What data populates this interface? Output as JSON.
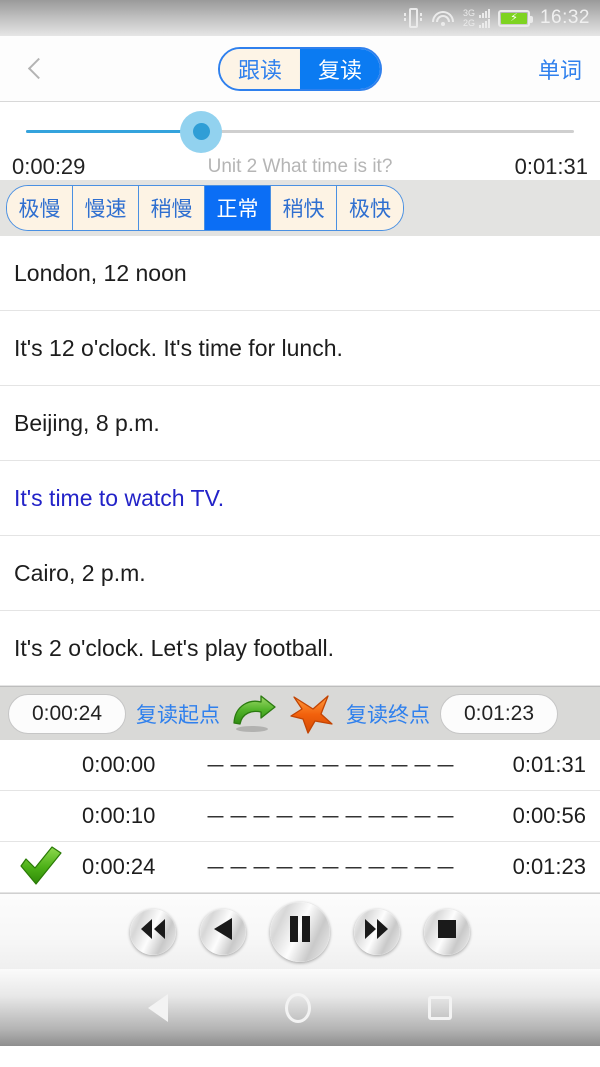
{
  "statusbar": {
    "time": "16:32",
    "signal_primary": "3G",
    "signal_secondary": "2G",
    "icons": [
      "vibrate-icon",
      "wifi-icon",
      "signal-icon",
      "battery-charging-icon"
    ]
  },
  "titlebar": {
    "back_icon": "chevron-left-icon",
    "tabs": [
      {
        "label": "跟读",
        "active": false
      },
      {
        "label": "复读",
        "active": true
      }
    ],
    "right_action": "单词"
  },
  "player": {
    "current_time": "0:00:29",
    "total_time": "0:01:31",
    "unit_title": "Unit 2 What time is it?",
    "progress_percent": 32,
    "track_color": "#34a3dd",
    "thumb_color": "#2f9ed6"
  },
  "speed": {
    "options": [
      {
        "label": "极慢",
        "selected": false
      },
      {
        "label": "慢速",
        "selected": false
      },
      {
        "label": "稍慢",
        "selected": false
      },
      {
        "label": "正常",
        "selected": true
      },
      {
        "label": "稍快",
        "selected": false
      },
      {
        "label": "极快",
        "selected": false
      }
    ],
    "selected_color": "#0b6ef5"
  },
  "sentences": [
    {
      "text": "London, 12 noon",
      "highlighted": false
    },
    {
      "text": "It's 12 o'clock. It's time for lunch.",
      "highlighted": false
    },
    {
      "text": "Beijing, 8 p.m.",
      "highlighted": false
    },
    {
      "text": "It's time to watch TV.",
      "highlighted": true
    },
    {
      "text": "Cairo, 2 p.m.",
      "highlighted": false
    },
    {
      "text": "It's 2 o'clock. Let's play football.",
      "highlighted": false
    }
  ],
  "repeat": {
    "start_value": "0:00:24",
    "start_label": "复读起点",
    "end_label": "复读终点",
    "end_value": "0:01:23",
    "start_icon": "curved-arrow-right-icon",
    "end_icon": "arrow-up-right-icon"
  },
  "markers": {
    "separator": "－－－－－－－－－－－",
    "rows": [
      {
        "checked": false,
        "start": "0:00:00",
        "end": "0:01:31"
      },
      {
        "checked": false,
        "start": "0:00:10",
        "end": "0:00:56"
      },
      {
        "checked": true,
        "start": "0:00:24",
        "end": "0:01:23"
      }
    ],
    "check_icon": "green-checkmark-icon"
  },
  "transport": {
    "buttons": [
      {
        "name": "rewind-button",
        "icon": "rewind-icon",
        "size": "small"
      },
      {
        "name": "previous-button",
        "icon": "play-left-icon",
        "size": "small"
      },
      {
        "name": "pause-button",
        "icon": "pause-icon",
        "size": "big"
      },
      {
        "name": "fast-forward-button",
        "icon": "fast-forward-icon",
        "size": "small"
      },
      {
        "name": "stop-button",
        "icon": "stop-icon",
        "size": "small"
      }
    ]
  },
  "navbar": {
    "back": "nav-back-icon",
    "home": "nav-home-icon",
    "recent": "nav-recent-icon"
  }
}
